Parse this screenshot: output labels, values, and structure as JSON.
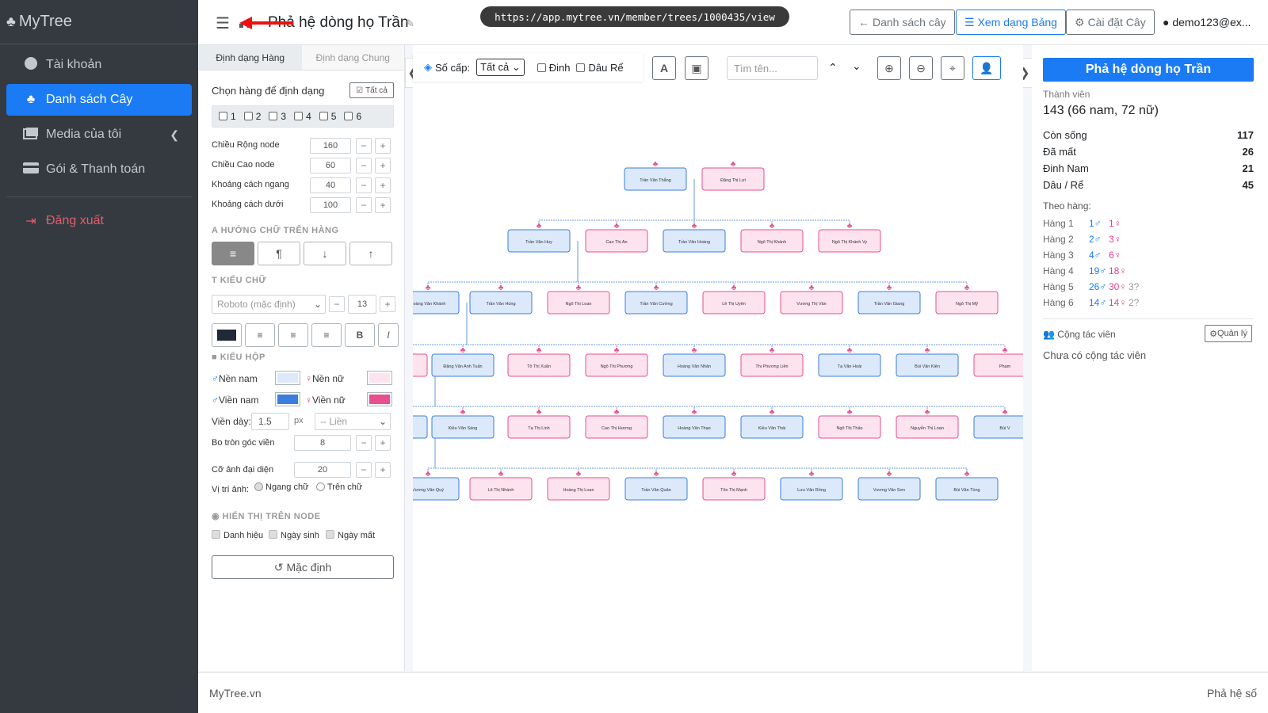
{
  "brand": {
    "name": "MyTree"
  },
  "sidebar": {
    "items": [
      {
        "label": "Tài khoản"
      },
      {
        "label": "Danh sách Cây"
      },
      {
        "label": "Media của tôi"
      },
      {
        "label": "Gói & Thanh toán"
      },
      {
        "label": "Đăng xuất"
      }
    ]
  },
  "header": {
    "title": "Phả hệ dòng họ Trần",
    "url": "https://app.mytree.vn/member/trees/1000435/view",
    "btn_list": "Danh sách cây",
    "btn_table": "Xem dạng Bảng",
    "btn_settings": "Cài đặt Cây",
    "user": "demo123@ex..."
  },
  "format": {
    "tab_row": "Định dạng Hàng",
    "tab_general": "Định dạng Chung",
    "choose_rows": "Chọn hàng để định dạng",
    "all_btn": "Tất cả",
    "rows": [
      "1",
      "2",
      "3",
      "4",
      "5",
      "6"
    ],
    "width_label": "Chiều Rộng node",
    "width_val": "160",
    "height_label": "Chiều Cao node",
    "height_val": "60",
    "hgap_label": "Khoảng cách ngang",
    "hgap_val": "40",
    "vgap_label": "Khoảng cách dưới",
    "vgap_val": "100",
    "text_dir": "HƯỚNG CHỮ TRÊN HÀNG",
    "font_sect": "KIỂU CHỮ",
    "font_sel": "Roboto (mặc định)",
    "font_size": "13",
    "box_sect": "KIỂU HỘP",
    "male_bg": "Nền nam",
    "female_bg": "Nền nữ",
    "male_border": "Viền nam",
    "female_border": "Viền nữ",
    "border_w_label": "Viền dày:",
    "border_w": "1.5",
    "px": "px",
    "border_style": "-- Liền",
    "radius_label": "Bo tròn góc viền",
    "radius_val": "8",
    "avatar_label": "Cỡ ảnh đại diện",
    "avatar_val": "20",
    "img_pos_label": "Vị trí ảnh:",
    "img_side": "Ngang chữ",
    "img_top": "Trên chữ",
    "display_sect": "HIỂN THỊ TRÊN NODE",
    "show_title": "Danh hiệu",
    "show_birth": "Ngày sinh",
    "show_death": "Ngày mất",
    "reset": "Mặc định"
  },
  "canvas": {
    "levels_label": "Số cấp:",
    "levels_val": "Tất cả",
    "dinh": "Đinh",
    "dau_re": "Dâu Rể",
    "search_ph": "Tìm tên..."
  },
  "tree": {
    "rows": [
      [
        {
          "n": "Trần Văn Thắng",
          "g": "m"
        },
        {
          "n": "Đặng Thị Lợi",
          "g": "f"
        }
      ],
      [
        {
          "n": "Trần Văn Huy",
          "g": "m"
        },
        {
          "n": "Cao Thị An",
          "g": "f"
        },
        {
          "n": "Trần Văn Hoàng",
          "g": "m"
        },
        {
          "n": "Ngô Thị Khánh",
          "g": "f"
        },
        {
          "n": "Ngô Thị Khánh Vy",
          "g": "f"
        }
      ],
      [
        {
          "n": "Hoàng Văn Khánh",
          "g": "m"
        },
        {
          "n": "Trần Văn Hùng",
          "g": "m"
        },
        {
          "n": "Ngô Thị Loan",
          "g": "f"
        },
        {
          "n": "Trần Văn Cường",
          "g": "m"
        },
        {
          "n": "Lê Thị Uyên",
          "g": "f"
        },
        {
          "n": "Vương Thị Vân",
          "g": "f"
        },
        {
          "n": "Trần Văn Giang",
          "g": "m"
        },
        {
          "n": "Ngô Thị Mỹ",
          "g": "f"
        }
      ],
      [
        {
          "n": "",
          "g": "f"
        },
        {
          "n": "Đặng Văn Anh Tuấn",
          "g": "m"
        },
        {
          "n": "Tô Thị Xuân",
          "g": "f"
        },
        {
          "n": "Ngô Thị Phương",
          "g": "f"
        },
        {
          "n": "Hoàng Văn Nhân",
          "g": "m"
        },
        {
          "n": "Thị Phương Liên",
          "g": "f"
        },
        {
          "n": "Tạ Văn Hoài",
          "g": "m"
        },
        {
          "n": "Bùi Văn Kiên",
          "g": "m"
        },
        {
          "n": "Phạm",
          "g": "f"
        }
      ],
      [
        {
          "n": "",
          "g": "m"
        },
        {
          "n": "Kiều Văn Sáng",
          "g": "m"
        },
        {
          "n": "Tạ Thị Linh",
          "g": "f"
        },
        {
          "n": "Cao Thị Hương",
          "g": "f"
        },
        {
          "n": "Hoàng Văn Thạo",
          "g": "m"
        },
        {
          "n": "Kiều Văn Thái",
          "g": "m"
        },
        {
          "n": "Ngô Thị Thảo",
          "g": "f"
        },
        {
          "n": "Nguyễn Thị Loan",
          "g": "f"
        },
        {
          "n": "Bùi V",
          "g": "m"
        }
      ],
      [
        {
          "n": "Vương Văn Quý",
          "g": "m"
        },
        {
          "n": "Lê Thị Nhành",
          "g": "f"
        },
        {
          "n": "Hoàng Thị Loan",
          "g": "f"
        },
        {
          "n": "Trần Văn Quân",
          "g": "m"
        },
        {
          "n": "Tôn Thị Mạnh",
          "g": "f"
        },
        {
          "n": "Lưu Văn Rồng",
          "g": "m"
        },
        {
          "n": "Vương Văn Sơn",
          "g": "m"
        },
        {
          "n": "Bùi Văn Tùng",
          "g": "m"
        }
      ]
    ]
  },
  "stats": {
    "title": "Phả hệ dòng họ Trần",
    "members_label": "Thành viên",
    "members_val": "143 (66 nam, 72 nữ)",
    "alive_label": "Còn sống",
    "alive_val": "117",
    "dead_label": "Đã mất",
    "dead_val": "26",
    "dinh_label": "Đinh Nam",
    "dinh_val": "21",
    "daure_label": "Dâu / Rể",
    "daure_val": "45",
    "by_gen": "Theo hàng:",
    "gens": [
      {
        "label": "Hàng 1",
        "m": "1♂",
        "f": "1♀",
        "u": ""
      },
      {
        "label": "Hàng 2",
        "m": "2♂",
        "f": "3♀",
        "u": ""
      },
      {
        "label": "Hàng 3",
        "m": "4♂",
        "f": "6♀",
        "u": ""
      },
      {
        "label": "Hàng 4",
        "m": "19♂",
        "f": "18♀",
        "u": ""
      },
      {
        "label": "Hàng 5",
        "m": "26♂",
        "f": "30♀",
        "u": "3?"
      },
      {
        "label": "Hàng 6",
        "m": "14♂",
        "f": "14♀",
        "u": "2?"
      }
    ],
    "collab_label": "Cộng tác viên",
    "manage": "Quản lý",
    "no_collab": "Chưa có cộng tác viên"
  },
  "footer": {
    "left": "MyTree.vn",
    "right": "Phả hệ số"
  },
  "colors": {
    "accent": "#1a7bf5",
    "male_bg": "#dce9fb",
    "male_border": "#3b7ddd",
    "female_bg": "#fde3ee",
    "female_border": "#e84f8f",
    "sidebar": "#343a40"
  }
}
